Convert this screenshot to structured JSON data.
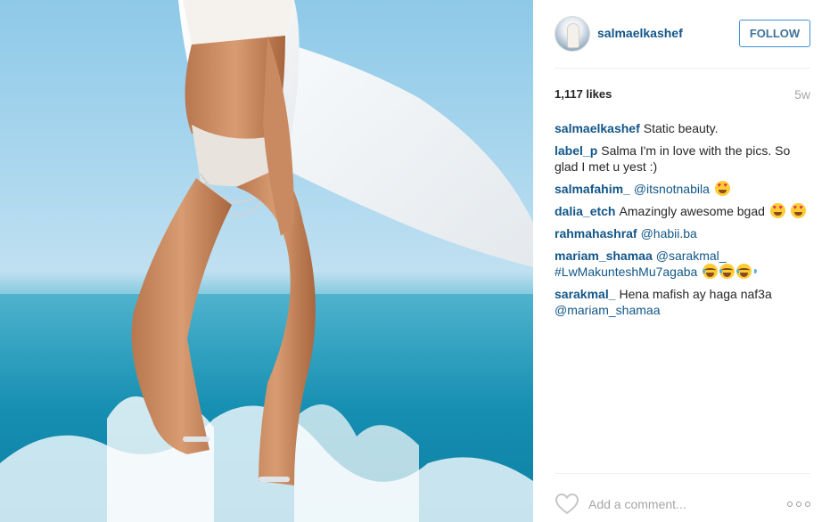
{
  "post": {
    "image_description_icon": "beach-photo"
  },
  "header": {
    "username": "salmaelkashef",
    "follow_label": "FOLLOW",
    "follow_color": "#3f729b"
  },
  "stats": {
    "likes": "1,117 likes",
    "time_ago": "5w"
  },
  "comments": [
    {
      "user": "salmaelkashef",
      "text": "Static beauty."
    },
    {
      "user": "label_p",
      "text": "Salma I'm in love with the pics. So glad I met u yest :)"
    },
    {
      "user": "salmafahim_",
      "mention": "@itsnotnabila"
    },
    {
      "user": "dalia_etch",
      "text": "Amazingly awesome bgad"
    },
    {
      "user": "rahmahashraf",
      "mention": "@habii.ba"
    },
    {
      "user": "mariam_shamaa",
      "mention": "@sarakmal_",
      "mention2": "#LwMakunteshMu7agaba"
    },
    {
      "user": "sarakmal_",
      "text": "Hena mafish ay haga naf3a",
      "mention": "@mariam_shamaa"
    }
  ],
  "footer": {
    "comment_placeholder": "Add a comment...",
    "like_icon": "heart-outline-icon",
    "more_icon": "more-options-icon"
  },
  "colors": {
    "username_blue": "#125688",
    "muted_gray": "#a5a7aa",
    "follow_border": "#4090db"
  }
}
